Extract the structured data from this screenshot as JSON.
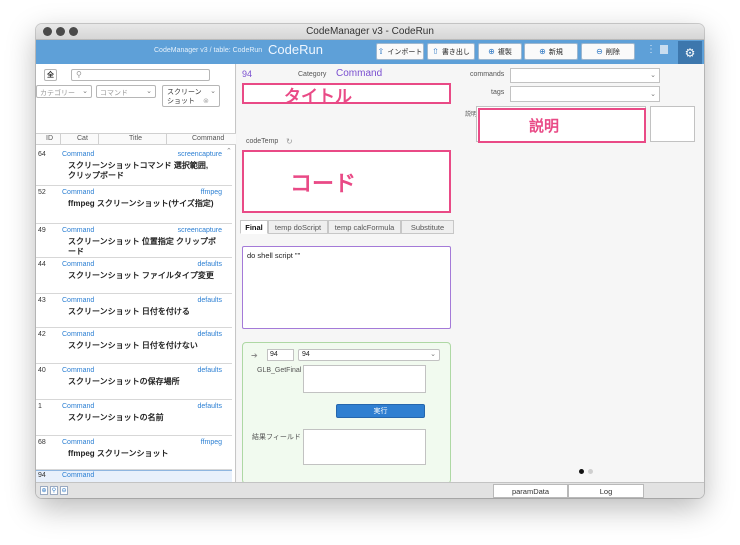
{
  "window": {
    "title": "CodeManager v3 - CodeRun"
  },
  "toolbar": {
    "breadcrumb": "CodeManager v3 / table: CodeRun",
    "brand": "CodeRun",
    "import_label": "インポート",
    "export_label": "書き出し",
    "duplicate_label": "複製",
    "new_label": "新規",
    "delete_label": "削除"
  },
  "sidebar": {
    "all_button": "全",
    "filter_category_placeholder": "カテゴリー",
    "filter_command_placeholder": "コマンド",
    "filter_command_value": "スクリーンショット",
    "columns": [
      "ID",
      "Cat",
      "Title",
      "Command"
    ],
    "rows": [
      {
        "id": "64",
        "cat": "Command",
        "command": "screencapture",
        "title": "スクリーンショットコマンド 選択範囲, クリップボード"
      },
      {
        "id": "52",
        "cat": "Command",
        "command": "ffmpeg",
        "title": "ffmpeg スクリーンショット(サイズ指定)"
      },
      {
        "id": "49",
        "cat": "Command",
        "command": "screencapture",
        "title": "スクリーンショット 位置指定 クリップボード"
      },
      {
        "id": "44",
        "cat": "Command",
        "command": "defaults",
        "title": "スクリーンショット ファイルタイプ変更"
      },
      {
        "id": "43",
        "cat": "Command",
        "command": "defaults",
        "title": "スクリーンショット 日付を付ける"
      },
      {
        "id": "42",
        "cat": "Command",
        "command": "defaults",
        "title": "スクリーンショット 日付を付けない"
      },
      {
        "id": "40",
        "cat": "Command",
        "command": "defaults",
        "title": "スクリーンショットの保存場所"
      },
      {
        "id": "1",
        "cat": "Command",
        "command": "defaults",
        "title": "スクリーンショットの名前"
      },
      {
        "id": "68",
        "cat": "Command",
        "command": "ffmpeg",
        "title": "ffmpeg スクリーンショット"
      },
      {
        "id": "94",
        "cat": "Command",
        "command": "",
        "title": ""
      }
    ]
  },
  "form": {
    "record_id": "94",
    "category_label": "Category",
    "category_value": "Command",
    "commands_label": "commands",
    "tags_label": "tags",
    "description_label": "説明",
    "title_annotation": "タイトル",
    "description_annotation": "説明",
    "code_label": "codeTemp",
    "code_annotation": "コード",
    "tabs": [
      "Final",
      "temp doScript",
      "temp calcFormula",
      "Substitute"
    ],
    "final_text": "do shell script \"\"",
    "param_id": "94",
    "param_select": "94",
    "glb_label": "GLB_GetFinal",
    "run_label": "実行",
    "result_label": "結果フィールド"
  },
  "bottom": {
    "param_data": "paramData",
    "log": "Log"
  }
}
